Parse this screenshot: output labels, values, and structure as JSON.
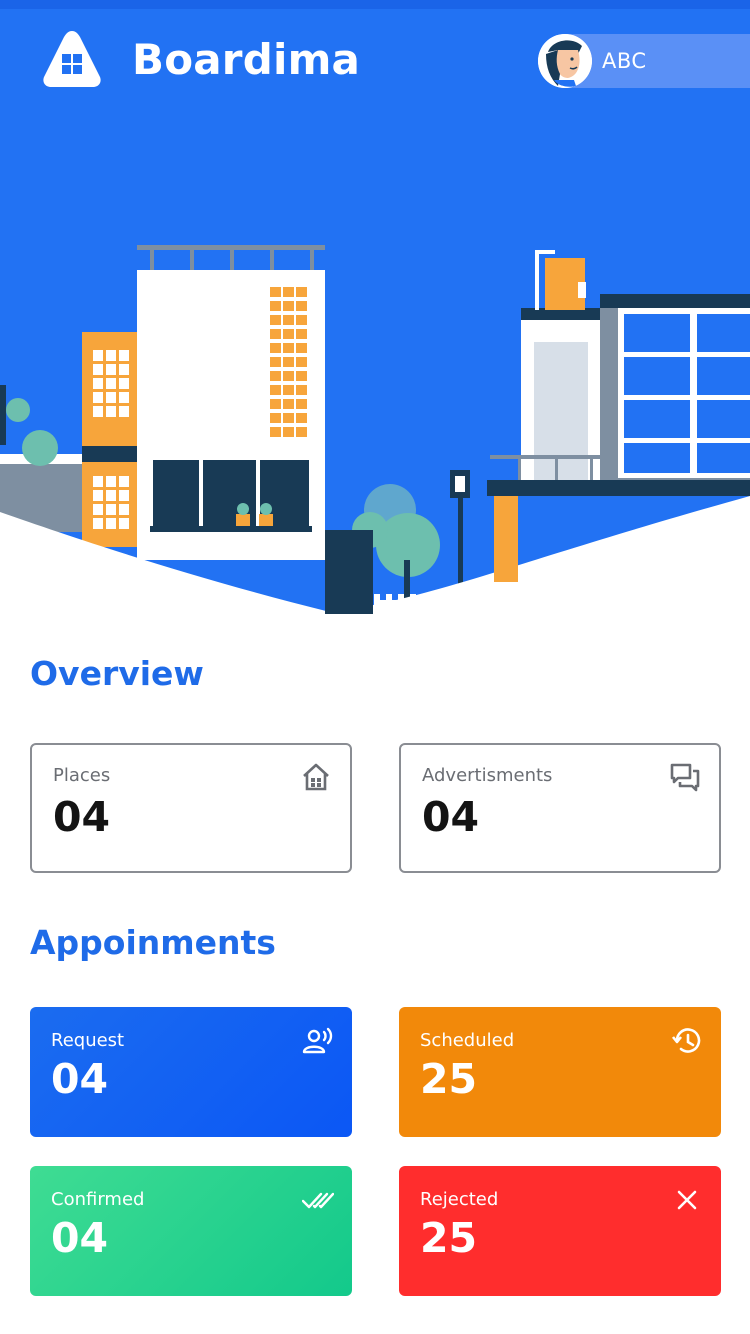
{
  "app": {
    "brand": "Boardima"
  },
  "user": {
    "name": "ABC"
  },
  "overview": {
    "title": "Overview",
    "cards": [
      {
        "label": "Places",
        "value": "04",
        "icon": "home-icon"
      },
      {
        "label": "Advertisments",
        "value": "04",
        "icon": "chat-icon"
      }
    ]
  },
  "appointments": {
    "title": "Appoinments",
    "cards": [
      {
        "label": "Request",
        "value": "04",
        "icon": "voice-person-icon",
        "color": "#1b6cf0"
      },
      {
        "label": "Scheduled",
        "value": "25",
        "icon": "history-icon",
        "color": "#f2890a"
      },
      {
        "label": "Confirmed",
        "value": "04",
        "icon": "double-check-icon",
        "color": "#2ed28f"
      },
      {
        "label": "Rejected",
        "value": "25",
        "icon": "close-icon",
        "color": "#ff2d2d"
      }
    ]
  },
  "colors": {
    "primary": "#2272f3",
    "accent": "#1f6be8"
  }
}
